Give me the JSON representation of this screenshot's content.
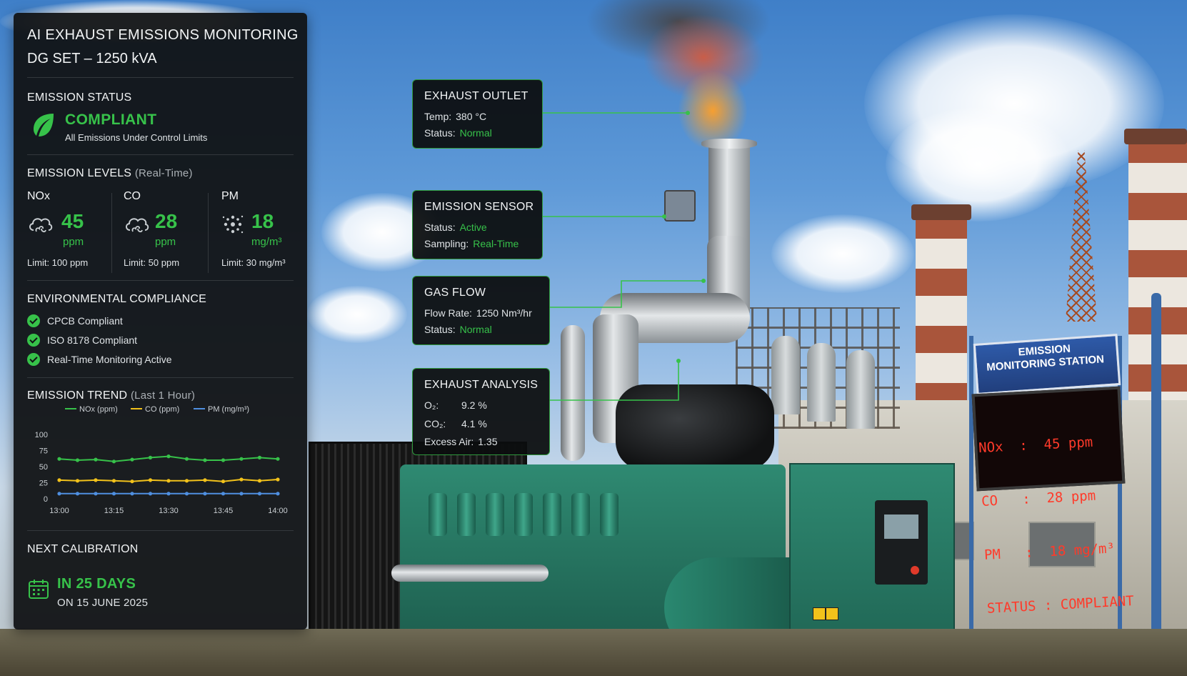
{
  "header": {
    "title_line1": "AI EXHAUST EMISSIONS MONITORING",
    "title_line2": "DG SET – 1250 kVA"
  },
  "emission_status": {
    "heading": "EMISSION STATUS",
    "status": "COMPLIANT",
    "detail": "All Emissions Under Control Limits"
  },
  "emission_levels": {
    "heading": "EMISSION LEVELS",
    "subheading": "(Real-Time)",
    "metrics": [
      {
        "name": "NOx",
        "value": "45",
        "unit": "ppm",
        "limit": "Limit: 100 ppm",
        "icon": "cloud-icon"
      },
      {
        "name": "CO",
        "value": "28",
        "unit": "ppm",
        "limit": "Limit: 50 ppm",
        "icon": "cloud-icon"
      },
      {
        "name": "PM",
        "value": "18",
        "unit": "mg/m³",
        "limit": "Limit: 30 mg/m³",
        "icon": "particles-icon"
      }
    ]
  },
  "compliance": {
    "heading": "ENVIRONMENTAL COMPLIANCE",
    "items": [
      "CPCB Compliant",
      "ISO 8178 Compliant",
      "Real-Time Monitoring Active"
    ]
  },
  "trend": {
    "heading": "EMISSION TREND",
    "subheading": "(Last 1 Hour)"
  },
  "chart_data": {
    "type": "line",
    "x": [
      "13:00",
      "13:05",
      "13:10",
      "13:15",
      "13:20",
      "13:25",
      "13:30",
      "13:35",
      "13:40",
      "13:45",
      "13:50",
      "13:55",
      "14:00"
    ],
    "x_ticks": [
      "13:00",
      "13:15",
      "13:30",
      "13:45",
      "14:00"
    ],
    "y_ticks": [
      0,
      25,
      50,
      75,
      100
    ],
    "ylim": [
      0,
      100
    ],
    "grid": false,
    "legend": "top",
    "series": [
      {
        "name": "NOx (ppm)",
        "color": "#37c24a",
        "values": [
          62,
          60,
          61,
          58,
          61,
          64,
          66,
          62,
          60,
          60,
          62,
          64,
          62
        ]
      },
      {
        "name": "CO (ppm)",
        "color": "#f2c21b",
        "values": [
          29,
          28,
          29,
          28,
          27,
          29,
          28,
          28,
          29,
          27,
          30,
          28,
          30
        ]
      },
      {
        "name": "PM (mg/m³)",
        "color": "#4f8fe0",
        "values": [
          8,
          8,
          8,
          8,
          8,
          8,
          8,
          8,
          8,
          8,
          8,
          8,
          8
        ]
      }
    ]
  },
  "calibration": {
    "heading": "NEXT CALIBRATION",
    "main": "IN 25 DAYS",
    "date": "ON 15 JUNE 2025"
  },
  "callouts": {
    "exhaust_outlet": {
      "title": "EXHAUST OUTLET",
      "temp_label": "Temp:",
      "temp_value": "380 °C",
      "status_label": "Status:",
      "status_value": "Normal"
    },
    "emission_sensor": {
      "title": "EMISSION SENSOR",
      "status_label": "Status:",
      "status_value": "Active",
      "sampling_label": "Sampling:",
      "sampling_value": "Real-Time"
    },
    "gas_flow": {
      "title": "GAS FLOW",
      "flow_label": "Flow Rate:",
      "flow_value": "1250 Nm³/hr",
      "status_label": "Status:",
      "status_value": "Normal"
    },
    "exhaust_analysis": {
      "title": "EXHAUST ANALYSIS",
      "o2_label": "O₂:",
      "o2_value": "9.2 %",
      "co2_label": "CO₂:",
      "co2_value": "4.1 %",
      "excess_label": "Excess Air:",
      "excess_value": "1.35"
    }
  },
  "station_sign": {
    "line1": "EMISSION",
    "line2": "MONITORING STATION",
    "led_lines": [
      "NOx  :  45 ppm",
      "CO   :  28 ppm",
      "PM   :  18 mg/m³",
      "STATUS : COMPLIANT"
    ]
  },
  "colors": {
    "accent": "#37c24a",
    "panel_bg": "#111315",
    "co_series": "#f2c21b",
    "pm_series": "#4f8fe0"
  }
}
